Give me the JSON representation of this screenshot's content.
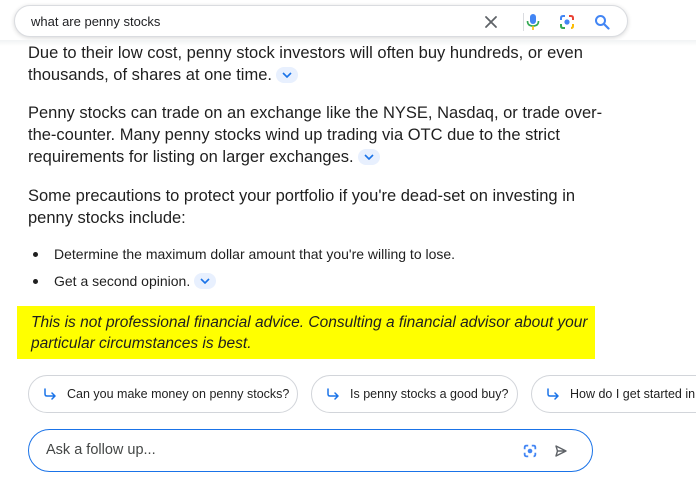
{
  "search": {
    "query": "what are penny stocks",
    "clear_icon": "close-icon",
    "mic_icon": "microphone-icon",
    "lens_icon": "google-lens-icon",
    "search_icon": "search-icon"
  },
  "content": {
    "para1": "Due to their low cost, penny stock investors will often buy hundreds, or even thousands, of shares at one time.",
    "para2": "Penny stocks can trade on an exchange like the NYSE, Nasdaq, or trade over-the-counter. Many penny stocks wind up trading via OTC due to the strict requirements for listing on larger exchanges.",
    "para3": "Some precautions to protect your portfolio if you're dead-set on investing in penny stocks include:",
    "bullets": [
      "Determine the maximum dollar amount that you're willing to lose.",
      "Get a second opinion."
    ],
    "disclaimer": "This is not professional financial advice. Consulting a financial advisor about your particular circumstances is best."
  },
  "suggestions": [
    "Can you make money on penny stocks?",
    "Is penny stocks a good buy?",
    "How do I get started in"
  ],
  "followup": {
    "placeholder": "Ask a follow up..."
  },
  "colors": {
    "highlight": "#ffff00",
    "accent": "#1a73e8",
    "chevron_bg": "#e8f0fe"
  }
}
